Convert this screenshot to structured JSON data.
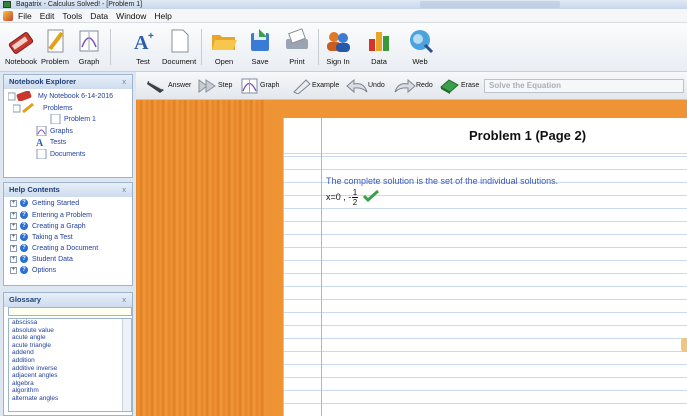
{
  "window": {
    "title": "Bagatrix - Calculus Solved! - [Problem 1]"
  },
  "menu": [
    "File",
    "Edit",
    "Tools",
    "Data",
    "Window",
    "Help"
  ],
  "toolbar": {
    "buttons": [
      "Notebook",
      "Problem",
      "Graph",
      "Test",
      "Document",
      "Open",
      "Save",
      "Print",
      "Sign In",
      "Data",
      "Web"
    ]
  },
  "notebook_explorer": {
    "title": "Notebook Explorer",
    "notebook": "My Notebook 6-14-2016",
    "problems": "Problems",
    "problem1": "Problem 1",
    "graphs": "Graphs",
    "tests": "Tests",
    "documents": "Documents"
  },
  "help_contents": {
    "title": "Help Contents",
    "items": [
      "Getting Started",
      "Entering a Problem",
      "Creating a Graph",
      "Taking a Test",
      "Creating a Document",
      "Student Data",
      "Options"
    ]
  },
  "glossary": {
    "title": "Glossary",
    "items": [
      "abscissa",
      "absolute value",
      "acute angle",
      "acute triangle",
      "addend",
      "addition",
      "additive inverse",
      "adjacent angles",
      "algebra",
      "algorithm",
      "alternate angles"
    ]
  },
  "actionbar": {
    "answer": "Answer",
    "step": "Step",
    "graph": "Graph",
    "example": "Example",
    "undo": "Undo",
    "redo": "Redo",
    "erase": "Erase",
    "solve_placeholder": "Solve the Equation"
  },
  "close_glyph": "x",
  "page": {
    "title": "Problem 1 (Page 2)",
    "solution_text": "The complete solution is the set of the individual solutions.",
    "answer_prefix": "x=0 , -",
    "frac_num": "1",
    "frac_den": "2"
  }
}
